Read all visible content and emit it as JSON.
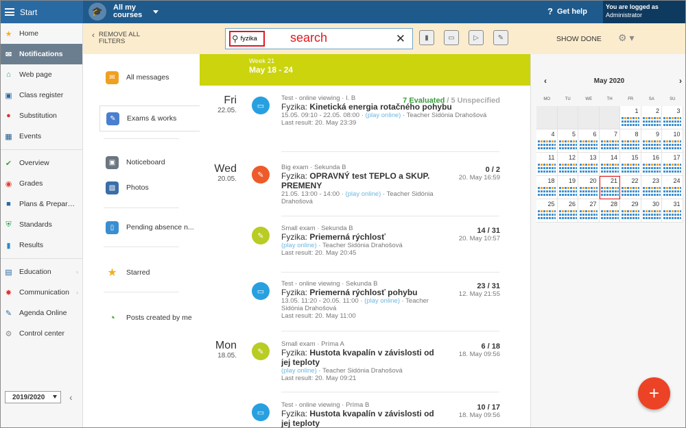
{
  "topbar": {
    "start_label": "Start",
    "courses_label": "All my courses",
    "help_label": "Get help",
    "logged_in_label": "You are logged as",
    "user_role": "Administrator"
  },
  "sidebar": {
    "items": [
      {
        "label": "Home",
        "icon": "star-icon"
      },
      {
        "label": "Notifications",
        "icon": "envelope-icon"
      },
      {
        "label": "Web page",
        "icon": "house-icon"
      },
      {
        "label": "Class register",
        "icon": "book-icon"
      },
      {
        "label": "Substitution",
        "icon": "person-icon"
      },
      {
        "label": "Events",
        "icon": "calendar-icon"
      },
      {
        "label": "Overview",
        "icon": "check-circle-icon"
      },
      {
        "label": "Grades",
        "icon": "grades-icon"
      },
      {
        "label": "Plans & Prepar…",
        "icon": "briefcase-icon"
      },
      {
        "label": "Standards",
        "icon": "shield-icon"
      },
      {
        "label": "Results",
        "icon": "bar-chart-icon"
      },
      {
        "label": "Education",
        "icon": "education-icon"
      },
      {
        "label": "Communication",
        "icon": "chat-icon"
      },
      {
        "label": "Agenda Online",
        "icon": "pen-icon"
      },
      {
        "label": "Control center",
        "icon": "gear-icon"
      }
    ],
    "year": "2019/2020"
  },
  "filter": {
    "remove_all_line1": "REMOVE ALL",
    "remove_all_line2": "FILTERS",
    "search_value": "fyzika",
    "annotation": "search",
    "show_done": "SHOW DONE"
  },
  "types": [
    {
      "label": "All messages"
    },
    {
      "label": "Exams & works"
    },
    {
      "label": "Noticeboard"
    },
    {
      "label": "Photos"
    },
    {
      "label": "Pending absence n..."
    },
    {
      "label": "Starred"
    },
    {
      "label": "Posts created by me"
    }
  ],
  "week": {
    "label": "Week 21",
    "range": "May 18 - 24"
  },
  "days": [
    {
      "name": "Fri",
      "date": "22.05."
    },
    {
      "name": "Wed",
      "date": "20.05."
    },
    {
      "name": "Mon",
      "date": "18.05."
    }
  ],
  "messages": [
    {
      "type": "Test - online viewing · I. B",
      "subject": "Fyzika:",
      "title": "Kinetická energia rotačného pohybu",
      "line1": "15.05. 09:10 - 22.05. 08:00 ·",
      "play": "(play online)",
      "teacher": "· Teacher Sidónia Drahošová",
      "last": "Last result: 20. May 23:39",
      "evaluated": "7 Evaluated",
      "slash": " / ",
      "unspecified": "5 Unspecified"
    },
    {
      "type": "Big exam · Sekunda B",
      "subject": "Fyzika:",
      "title": "OPRAVNÝ test TEPLO a SKUP. PREMENY",
      "line1": "21.05. 13:00 - 14:00 ·",
      "play": "(play online)",
      "teacher": "· Teacher Sidónia Drahošová",
      "score": "0 / 2",
      "date": "20. May 16:59"
    },
    {
      "type": "Small exam · Sekunda B",
      "subject": "Fyzika:",
      "title": "Priemerná rýchlosť",
      "play": "(play online)",
      "teacher": "· Teacher Sidónia Drahošová",
      "last": "Last result: 20. May 20:45",
      "score": "14 / 31",
      "date": "20. May 10:57"
    },
    {
      "type": "Test - online viewing · Sekunda B",
      "subject": "Fyzika:",
      "title": "Priemerná rýchlosť pohybu",
      "line1": "13.05. 11:20 - 20.05. 11:00 ·",
      "play": "(play online)",
      "teacher": "· Teacher Sidónia Drahošová",
      "last": "Last result: 20. May 11:00",
      "score": "23 / 31",
      "date": "12. May 21:55"
    },
    {
      "type": "Small exam · Príma A",
      "subject": "Fyzika:",
      "title": "Hustota kvapalín v závislosti od jej teploty",
      "play": "(play online)",
      "teacher": "· Teacher Sidónia Drahošová",
      "last": "Last result: 20. May 09:21",
      "score": "6 / 18",
      "date": "18. May 09:56"
    },
    {
      "type": "Test - online viewing · Príma B",
      "subject": "Fyzika:",
      "title": "Hustota kvapalín v závislosti od jej teploty",
      "score": "10 / 17",
      "date": "18. May 09:56"
    }
  ],
  "calendar": {
    "month": "May 2020",
    "weekdays": [
      "MO",
      "TU",
      "WE",
      "TH",
      "FR",
      "SA",
      "SU"
    ],
    "weeks": [
      [
        "",
        "",
        "",
        "",
        "1",
        "2",
        "3"
      ],
      [
        "4",
        "5",
        "6",
        "7",
        "8",
        "9",
        "10"
      ],
      [
        "11",
        "12",
        "13",
        "14",
        "15",
        "16",
        "17"
      ],
      [
        "18",
        "19",
        "20",
        "21",
        "22",
        "23",
        "24"
      ],
      [
        "25",
        "26",
        "27",
        "28",
        "29",
        "30",
        "31"
      ]
    ],
    "today": "21"
  },
  "colors": {
    "topbar": "#1f5a8c",
    "filterbar": "#fbeccd",
    "week_header": "#cbd40d",
    "fab": "#ec4225",
    "annotation": "#e1171e"
  }
}
